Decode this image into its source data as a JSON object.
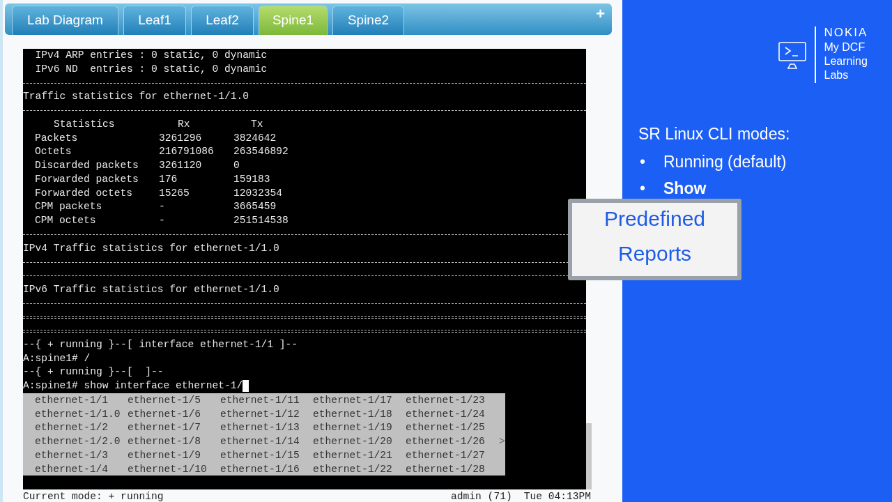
{
  "tabs": [
    {
      "label": "Lab Diagram",
      "selected": false
    },
    {
      "label": "Leaf1",
      "selected": false
    },
    {
      "label": "Leaf2",
      "selected": false
    },
    {
      "label": "Spine1",
      "selected": true
    },
    {
      "label": "Spine2",
      "selected": false
    }
  ],
  "add_tab": "+",
  "terminal": {
    "lines": [
      {
        "kind": "text",
        "text": "  IPv4 ARP entries : 0 static, 0 dynamic"
      },
      {
        "kind": "text",
        "text": "  IPv6 ND  entries : 0 static, 0 dynamic"
      },
      {
        "kind": "rule"
      },
      {
        "kind": "text",
        "text": "Traffic statistics for ethernet-1/1.0"
      },
      {
        "kind": "rule"
      },
      {
        "kind": "stats_header",
        "cells": [
          "Statistics",
          "Rx",
          "Tx"
        ]
      },
      {
        "kind": "stats_row",
        "cells": [
          "Packets",
          "3261296",
          "3824642"
        ]
      },
      {
        "kind": "stats_row",
        "cells": [
          "Octets",
          "216791086",
          "263546892"
        ]
      },
      {
        "kind": "stats_row",
        "cells": [
          "Discarded packets",
          "3261120",
          "0"
        ]
      },
      {
        "kind": "stats_row",
        "cells": [
          "Forwarded packets",
          "176",
          "159183"
        ]
      },
      {
        "kind": "stats_row",
        "cells": [
          "Forwarded octets",
          "15265",
          "12032354"
        ]
      },
      {
        "kind": "stats_row",
        "cells": [
          "CPM packets",
          "-",
          "3665459"
        ]
      },
      {
        "kind": "stats_row",
        "cells": [
          "CPM octets",
          "-",
          "251514538"
        ]
      },
      {
        "kind": "rule"
      },
      {
        "kind": "text",
        "text": "IPv4 Traffic statistics for ethernet-1/1.0"
      },
      {
        "kind": "rule"
      },
      {
        "kind": "rule"
      },
      {
        "kind": "text",
        "text": "IPv6 Traffic statistics for ethernet-1/1.0"
      },
      {
        "kind": "rule"
      },
      {
        "kind": "double_rule"
      },
      {
        "kind": "double_rule"
      },
      {
        "kind": "text",
        "text": "--{ + running }--[ interface ethernet-1/1 ]--"
      },
      {
        "kind": "text",
        "text": "A:spine1# /"
      },
      {
        "kind": "text",
        "text": "--{ + running }--[  ]--"
      },
      {
        "kind": "prompt",
        "text": "A:spine1# show interface ethernet-1/",
        "cursor": true
      }
    ],
    "completions": {
      "columns": [
        [
          "ethernet-1/1",
          "ethernet-1/1.0",
          "ethernet-1/2",
          "ethernet-1/2.0",
          "ethernet-1/3",
          "ethernet-1/4"
        ],
        [
          "ethernet-1/5",
          "ethernet-1/6",
          "ethernet-1/7",
          "ethernet-1/8",
          "ethernet-1/9",
          "ethernet-1/10"
        ],
        [
          "ethernet-1/11",
          "ethernet-1/12",
          "ethernet-1/13",
          "ethernet-1/14",
          "ethernet-1/15",
          "ethernet-1/16"
        ],
        [
          "ethernet-1/17",
          "ethernet-1/18",
          "ethernet-1/19",
          "ethernet-1/20",
          "ethernet-1/21",
          "ethernet-1/22"
        ],
        [
          "ethernet-1/23",
          "ethernet-1/24",
          "ethernet-1/25",
          "ethernet-1/26",
          "ethernet-1/27",
          "ethernet-1/28"
        ]
      ],
      "more": ">"
    }
  },
  "status_bar": {
    "mode": "Current mode: + running",
    "user": "admin (71)",
    "time": "Tue 04:13PM"
  },
  "slide": {
    "brand": "NOKIA",
    "product": [
      "My DCF",
      "Learning",
      "Labs"
    ],
    "heading": "SR Linux CLI modes:",
    "bullets": [
      {
        "marker": "•",
        "text": "Running (default)",
        "bold": false
      },
      {
        "marker": "•",
        "text": "Show",
        "bold": true
      }
    ],
    "callout": "Predefined Reports"
  }
}
